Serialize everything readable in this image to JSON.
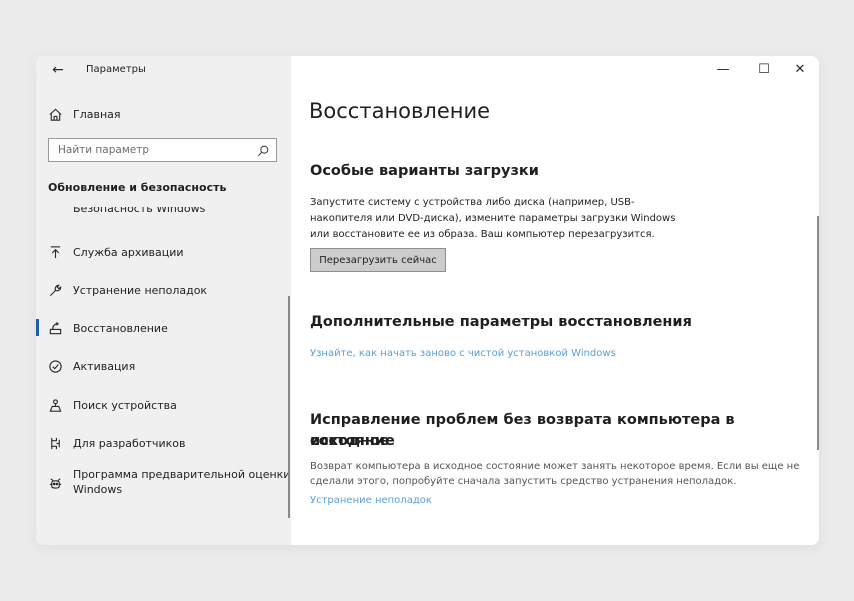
{
  "window": {
    "title": "Параметры",
    "controls": {
      "minimize": "—",
      "maximize": "☐",
      "close": "✕"
    }
  },
  "sidebar": {
    "home": {
      "label": "Главная",
      "icon": "home-icon"
    },
    "search": {
      "placeholder": "Найти параметр",
      "icon": "search-icon"
    },
    "section_title": "Обновление и безопасность",
    "cutoff_item": "Безопасность Windows",
    "items": [
      {
        "label": "Служба архивации",
        "icon": "backup-icon"
      },
      {
        "label": "Устранение неполадок",
        "icon": "wrench-icon"
      },
      {
        "label": "Восстановление",
        "icon": "recovery-icon",
        "active": true
      },
      {
        "label": "Активация",
        "icon": "activation-icon"
      },
      {
        "label": "Поиск устройства",
        "icon": "find-device-icon"
      },
      {
        "label": "Для разработчиков",
        "icon": "developer-icon"
      },
      {
        "label_line1": "Программа предварительной оценки",
        "label_line2": "Windows",
        "icon": "insider-icon"
      }
    ]
  },
  "main": {
    "title": "Восстановление",
    "section1": {
      "heading": "Особые варианты загрузки",
      "lines": [
        "Запустите систему с устройства либо диска (например, USB-",
        "накопителя или DVD-диска), измените параметры загрузки Windows",
        "или восстановите ее из образа. Ваш компьютер перезагрузится."
      ],
      "button": "Перезагрузить сейчас"
    },
    "section2": {
      "heading": "Дополнительные параметры восстановления",
      "link": "Узнайте, как начать заново с чистой установкой Windows"
    },
    "section3": {
      "heading_line1": "Исправление проблем без возврата компьютера в исходное",
      "heading_line2": "состояние",
      "lines": [
        "Возврат компьютера в исходное состояние может занять некоторое время. Если вы еще не",
        "сделали этого, попробуйте сначала запустить средство устранения неполадок."
      ],
      "link": "Устранение неполадок"
    }
  },
  "colors": {
    "accent": "#1f5fa7",
    "link": "#5a9fd6",
    "sidebar_bg": "#f0f0f0"
  }
}
